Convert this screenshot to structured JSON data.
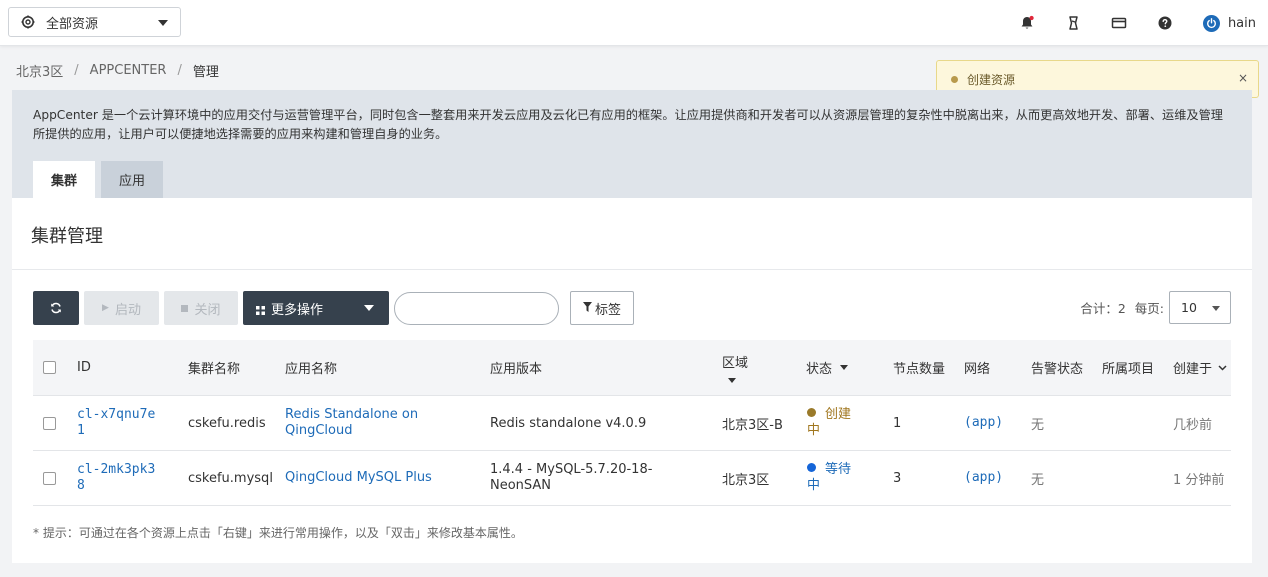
{
  "topbar": {
    "resource_select": "全部资源",
    "user": "hain"
  },
  "breadcrumb": {
    "zone": "北京3区",
    "app": "APPCENTER",
    "current": "管理"
  },
  "toast": {
    "message": "创建资源",
    "close": "×"
  },
  "description": "AppCenter 是一个云计算环境中的应用交付与运营管理平台，同时包含一整套用来开发云应用及云化已有应用的框架。让应用提供商和开发者可以从资源层管理的复杂性中脱离出来，从而更高效地开发、部署、运维及管理所提供的应用，让用户可以便捷地选择需要的应用来构建和管理自身的业务。",
  "tabs": [
    {
      "label": "集群"
    },
    {
      "label": "应用"
    }
  ],
  "panel": {
    "title": "集群管理"
  },
  "toolbar": {
    "start": "启动",
    "stop": "关闭",
    "more": "更多操作",
    "tag": "标签",
    "search_placeholder": ""
  },
  "pager": {
    "total": "合计：2",
    "per_page_label": "每页:",
    "per_page": "10"
  },
  "table": {
    "headers": {
      "id": "ID",
      "cluster_name": "集群名称",
      "app_name": "应用名称",
      "app_version": "应用版本",
      "region": "区域",
      "status": "状态",
      "node_count": "节点数量",
      "network": "网络",
      "alarm": "告警状态",
      "project": "所属项目",
      "created": "创建于"
    },
    "rows": [
      {
        "id_line1": "cl-x7qnu7e",
        "id_line2": "1",
        "cluster_name": "cskefu.redis",
        "app_name_line1": "Redis Standalone on",
        "app_name_line2": "QingCloud",
        "app_version_line1": "Redis standalone v4.0.9",
        "app_version_line2": "",
        "region": "北京3区-B",
        "status_line1": "创建",
        "status_line2": "中",
        "status_color": "#a0761e",
        "status_dot": "#9a7a2a",
        "node_count": "1",
        "network": "(app)",
        "alarm": "无",
        "project": "",
        "created": "几秒前"
      },
      {
        "id_line1": "cl-2mk3pk3",
        "id_line2": "8",
        "cluster_name": "cskefu.mysql",
        "app_name_line1": "QingCloud MySQL Plus",
        "app_name_line2": "",
        "app_version_line1": "1.4.4 - MySQL-5.7.20-18-",
        "app_version_line2": "NeonSAN",
        "region": "北京3区",
        "status_line1": "等待",
        "status_line2": "中",
        "status_color": "#1e6bb8",
        "status_dot": "#1565d8",
        "node_count": "3",
        "network": "(app)",
        "alarm": "无",
        "project": "",
        "created": "1 分钟前"
      }
    ]
  },
  "hint": "* 提示：可通过在各个资源上点击「右键」来进行常用操作，以及「双击」来修改基本属性。",
  "colors": {
    "accent": "#1e6bb8",
    "dark_button": "#36414d",
    "toast_bg": "#fdf7dc"
  }
}
